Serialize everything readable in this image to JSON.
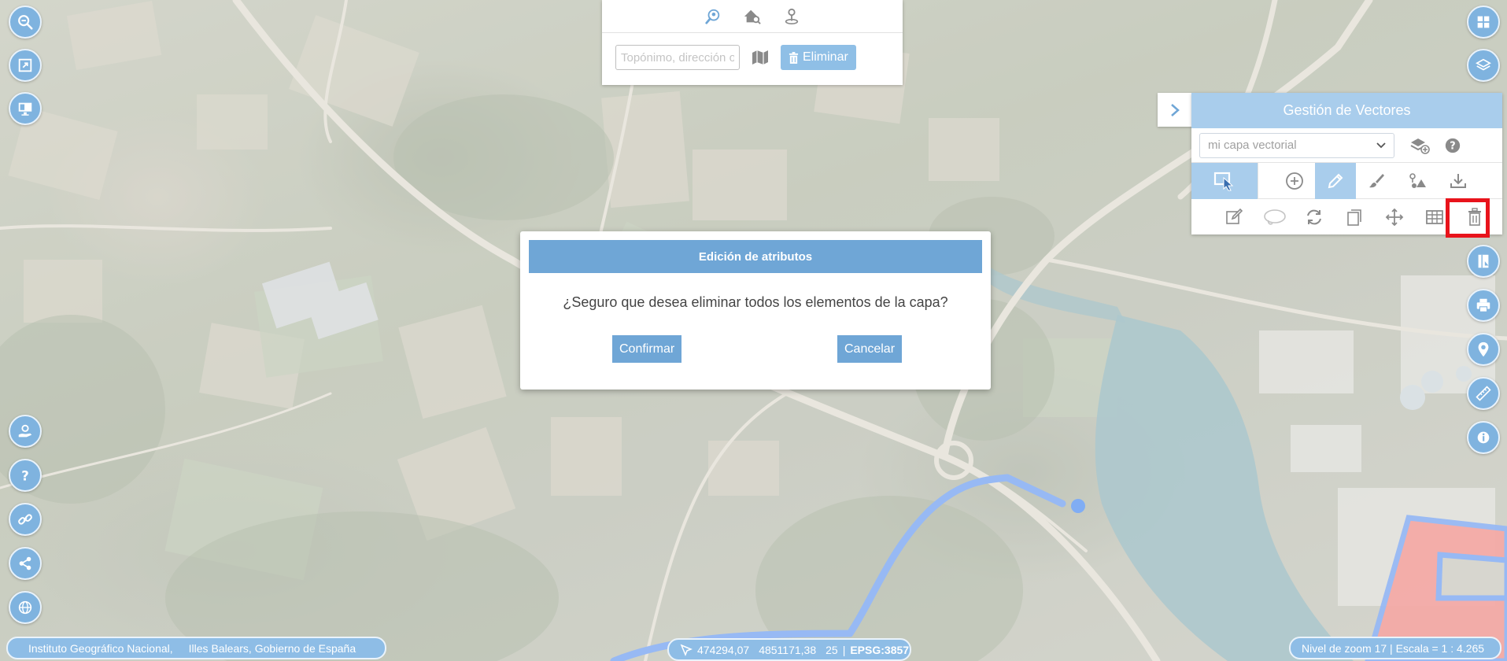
{
  "colors": {
    "accent": "#6fa6d6",
    "button_light": "#8fbfe6",
    "panel_header": "#a9cdec",
    "highlight": "#e8131b",
    "polygon_fill": "#ef8a84",
    "line": "#6f9ef0"
  },
  "left_toolbar": {
    "top": [
      {
        "icon": "zoom-search-icon"
      },
      {
        "icon": "fullscreen-icon"
      },
      {
        "icon": "screen-icon"
      }
    ],
    "bottom": [
      {
        "icon": "hand-location-icon"
      },
      {
        "icon": "help-icon"
      },
      {
        "icon": "link-icon"
      },
      {
        "icon": "share-icon"
      },
      {
        "icon": "globe-icon"
      }
    ]
  },
  "search": {
    "tabs": [
      {
        "icon": "search-location-icon"
      },
      {
        "icon": "house-search-icon"
      },
      {
        "icon": "map-pin-icon"
      }
    ],
    "placeholder": "Topónimo, dirección o cód",
    "delete_label": "Eliminar"
  },
  "vector_panel": {
    "title": "Gestión de Vectores",
    "layer_selected": "mi capa vectorial",
    "tools": [
      {
        "icon": "select-cursor-icon"
      },
      {
        "icon": "add-circle-icon"
      },
      {
        "icon": "pencil-icon"
      },
      {
        "icon": "brush-icon"
      },
      {
        "icon": "shapes-icon"
      },
      {
        "icon": "download-icon"
      }
    ],
    "edit_tools": [
      {
        "icon": "edit-icon"
      },
      {
        "icon": "lasso-icon"
      },
      {
        "icon": "rotate-icon"
      },
      {
        "icon": "copy-icon"
      },
      {
        "icon": "move-icon"
      },
      {
        "icon": "table-icon"
      },
      {
        "icon": "trash-icon"
      }
    ]
  },
  "right_toolbar": [
    {
      "icon": "grid-icon"
    },
    {
      "icon": "layers-icon"
    },
    {
      "icon": "book-icon"
    },
    {
      "icon": "print-icon"
    },
    {
      "icon": "location-info-icon"
    },
    {
      "icon": "ruler-icon"
    },
    {
      "icon": "info-icon"
    }
  ],
  "modal": {
    "title": "Edición de atributos",
    "message": "¿Seguro que desea eliminar todos los elementos de la capa?",
    "confirm_label": "Confirmar",
    "cancel_label": "Cancelar"
  },
  "footer": {
    "attribution_1": "Instituto Geográfico Nacional,",
    "attribution_2": "Illes Balears, Gobierno de España",
    "coord_x": "474294,07",
    "coord_y": "4851171,38",
    "utm_zone": "25",
    "epsg": "EPSG:3857",
    "zoom_info": "Nivel de zoom 17 | Escala = 1 : 4.265"
  }
}
